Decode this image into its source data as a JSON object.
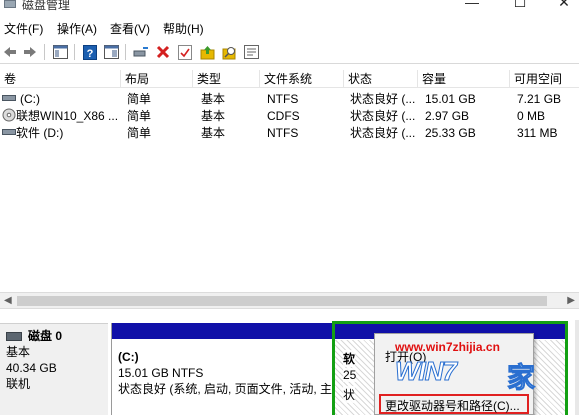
{
  "window": {
    "title": "磁盘管理"
  },
  "window_buttons": {
    "minimize": "—",
    "maximize": "☐",
    "close": "✕"
  },
  "menu": [
    {
      "label": "文件(F)"
    },
    {
      "label": "操作(A)"
    },
    {
      "label": "查看(V)"
    },
    {
      "label": "帮助(H)"
    }
  ],
  "toolbar": {
    "icons": [
      "back-icon",
      "forward-icon",
      "console-tree-icon",
      "help-icon",
      "properties-icon",
      "disk-connect-icon",
      "delete-icon",
      "check-icon",
      "import-icon",
      "search-icon",
      "settings-icon"
    ],
    "colors": {
      "delete": "#d42020",
      "help": "#1c5fb0",
      "import": "#3a9a2a",
      "folder": "#e6b800"
    }
  },
  "volume_table": {
    "columns": [
      "卷",
      "布局",
      "类型",
      "文件系统",
      "状态",
      "容量",
      "可用空间"
    ],
    "rows": [
      {
        "volume": "(C:)",
        "layout": "简单",
        "type": "基本",
        "fs": "NTFS",
        "status": "状态良好 (...",
        "capacity": "15.01 GB",
        "free": "7.21 GB"
      },
      {
        "volume": "联想WIN10_X86 ...",
        "layout": "简单",
        "type": "基本",
        "fs": "CDFS",
        "status": "状态良好 (...",
        "capacity": "2.97 GB",
        "free": "0 MB"
      },
      {
        "volume": "软件 (D:)",
        "layout": "简单",
        "type": "基本",
        "fs": "NTFS",
        "status": "状态良好 (...",
        "capacity": "25.33 GB",
        "free": "311 MB"
      }
    ]
  },
  "disk0": {
    "name": "磁盘 0",
    "kind": "基本",
    "size": "40.34 GB",
    "state": "联机"
  },
  "partition_c": {
    "label": "(C:)",
    "size": "15.01 GB NTFS",
    "status": "状态良好 (系统, 启动, 页面文件, 活动, 主"
  },
  "partition_d": {
    "label": "软",
    "size": "25",
    "status": "状"
  },
  "context_menu": {
    "open": "打开(O)",
    "change_letter": "更改驱动器号和路径(C)..."
  },
  "watermark": {
    "url": "www.win7zhijia.cn",
    "logo": "WIN7",
    "home": "家"
  },
  "colors": {
    "partition_bar": "#1010a8",
    "selected_border": "#13a013",
    "highlight_box": "#e02020"
  }
}
